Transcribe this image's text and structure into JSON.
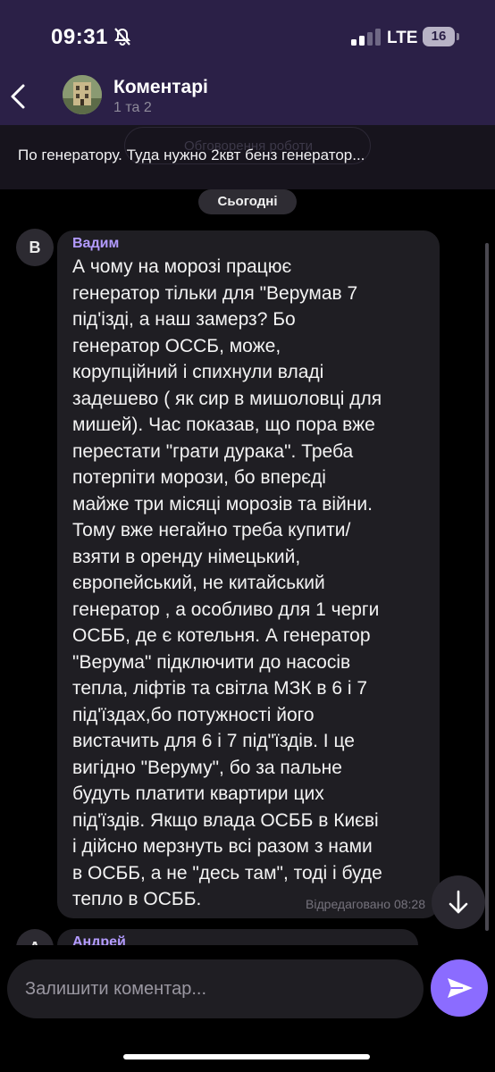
{
  "status_bar": {
    "time": "09:31",
    "network": "LTE",
    "battery": "16"
  },
  "header": {
    "title": "Коментарі",
    "subtitle": "1 та 2"
  },
  "pinned": {
    "background_label": "Обговорення роботи",
    "text": "По генератору. Туда нужно 2квт бенз генератор..."
  },
  "date_separator": "Сьогодні",
  "messages": [
    {
      "avatar_letter": "В",
      "author": "Вадим",
      "text": "А чому на  морозі працює\nгенератор тільки для \"Верумав 7\nпід'ізді, а наш замерз? Бо\nгенератор ОССБ,  може,\nкорупційний і спихнули владі\nзадешево ( як сир в мишоловці для\nмишей). Час показав, що пора вже\nперестати \"грати дурака\". Треба\nпотерпіти морози, бо вперєді\nмайже три місяці морозів та війни.\nТому вже негайно треба купити/\nвзяти в оренду німецький,\nєвропейський, не китайський\nгенератор , а особливо для 1 черги\nОСББ, де є котельня. А генератор\n\"Верума\" підключити до насосів\nтепла, ліфтів та світла МЗК в 6 і 7\nпід'їздах,бо потужності його\nвистачить для 6 і 7 під\"їздів. І це\nвигідно \"Веруму\", бо за пальне\nбудуть платити квартири цих\nпід'їздів. Якщо влада ОСББ в Києві\nі дійсно мерзнуть всі разом з нами\nв ОСББ, а не \"десь там\", тоді і буде\nтепло в ОСББ.",
      "edited": "Відредаговано",
      "time": "08:28"
    },
    {
      "avatar_letter": "А",
      "author": "Андрей"
    }
  ],
  "composer": {
    "placeholder": "Залишити коментар..."
  },
  "colors": {
    "header_bg": "#2b2047",
    "accent": "#8b6cff",
    "author": "#b39bff"
  }
}
